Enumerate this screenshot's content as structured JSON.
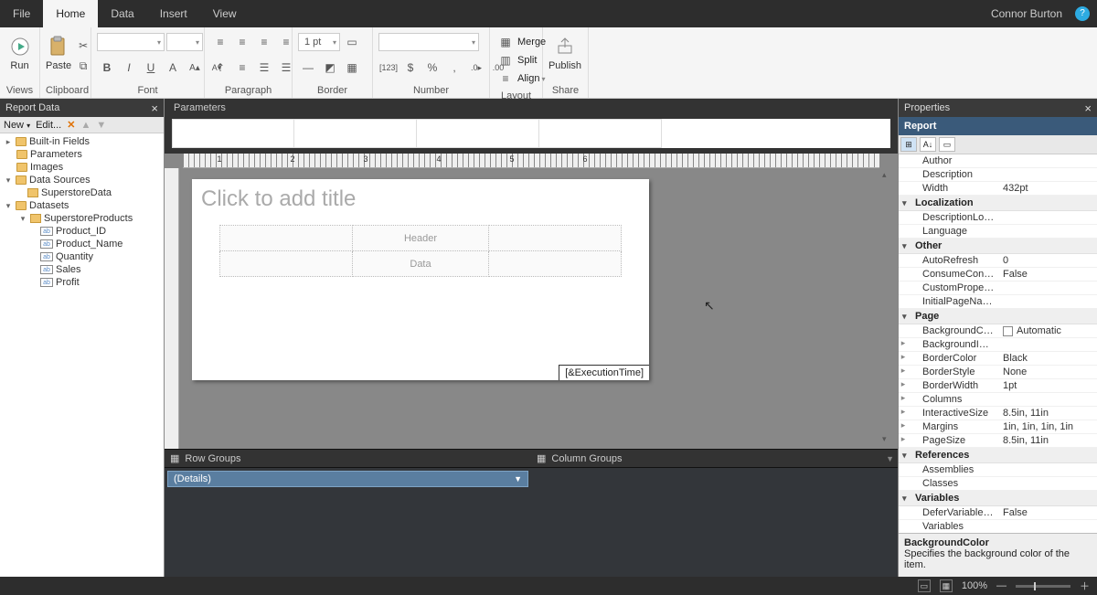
{
  "tabs": {
    "file": "File",
    "home": "Home",
    "data": "Data",
    "insert": "Insert",
    "view": "View"
  },
  "user": "Connor Burton",
  "ribbon": {
    "views": {
      "run": "Run",
      "label": "Views"
    },
    "clipboard": {
      "paste": "Paste",
      "label": "Clipboard"
    },
    "font": {
      "label": "Font"
    },
    "paragraph": {
      "label": "Paragraph"
    },
    "border": {
      "label": "Border",
      "size": "1 pt"
    },
    "number": {
      "label": "Number"
    },
    "layout": {
      "label": "Layout",
      "merge": "Merge",
      "split": "Split",
      "align": "Align"
    },
    "share": {
      "label": "Share",
      "publish": "Publish"
    }
  },
  "leftpanel": {
    "title": "Report Data",
    "new": "New",
    "edit": "Edit...",
    "nodes": {
      "builtin": "Built-in Fields",
      "parameters": "Parameters",
      "images": "Images",
      "datasources": "Data Sources",
      "ds1": "SuperstoreData",
      "datasets": "Datasets",
      "dset1": "SuperstoreProducts",
      "fields": [
        "Product_ID",
        "Product_Name",
        "Quantity",
        "Sales",
        "Profit"
      ]
    }
  },
  "center": {
    "parameters": "Parameters",
    "titlePlaceholder": "Click to add title",
    "header": "Header",
    "data": "Data",
    "exectime": "[&ExecutionTime]",
    "rowgroups": "Row Groups",
    "colgroups": "Column Groups",
    "details": "(Details)",
    "rulerMarks": [
      "1",
      "2",
      "3",
      "4",
      "5",
      "6"
    ]
  },
  "props": {
    "title": "Properties",
    "object": "Report",
    "rows": {
      "author": "Author",
      "description": "Description",
      "width": "Width",
      "width_v": "432pt",
      "cat_localization": "Localization",
      "desclocid": "DescriptionLocID",
      "language": "Language",
      "cat_other": "Other",
      "autorefresh": "AutoRefresh",
      "autorefresh_v": "0",
      "consume": "ConsumeContainerW",
      "consume_v": "False",
      "customprops": "CustomProperties",
      "initialpage": "InitialPageName",
      "cat_page": "Page",
      "bgcolor": "BackgroundColor",
      "bgcolor_v": "Automatic",
      "bgimage": "BackgroundImage",
      "bordercolor": "BorderColor",
      "bordercolor_v": "Black",
      "borderstyle": "BorderStyle",
      "borderstyle_v": "None",
      "borderwidth": "BorderWidth",
      "borderwidth_v": "1pt",
      "columns": "Columns",
      "intsize": "InteractiveSize",
      "intsize_v": "8.5in, 11in",
      "margins": "Margins",
      "margins_v": "1in, 1in, 1in, 1in",
      "pagesize": "PageSize",
      "pagesize_v": "8.5in, 11in",
      "cat_references": "References",
      "assemblies": "Assemblies",
      "classes": "Classes",
      "cat_variables": "Variables",
      "defervar": "DeferVariableEvaluati",
      "defervar_v": "False",
      "variables": "Variables"
    },
    "desc_title": "BackgroundColor",
    "desc_body": "Specifies the background color of the item."
  },
  "status": {
    "zoom": "100%"
  }
}
